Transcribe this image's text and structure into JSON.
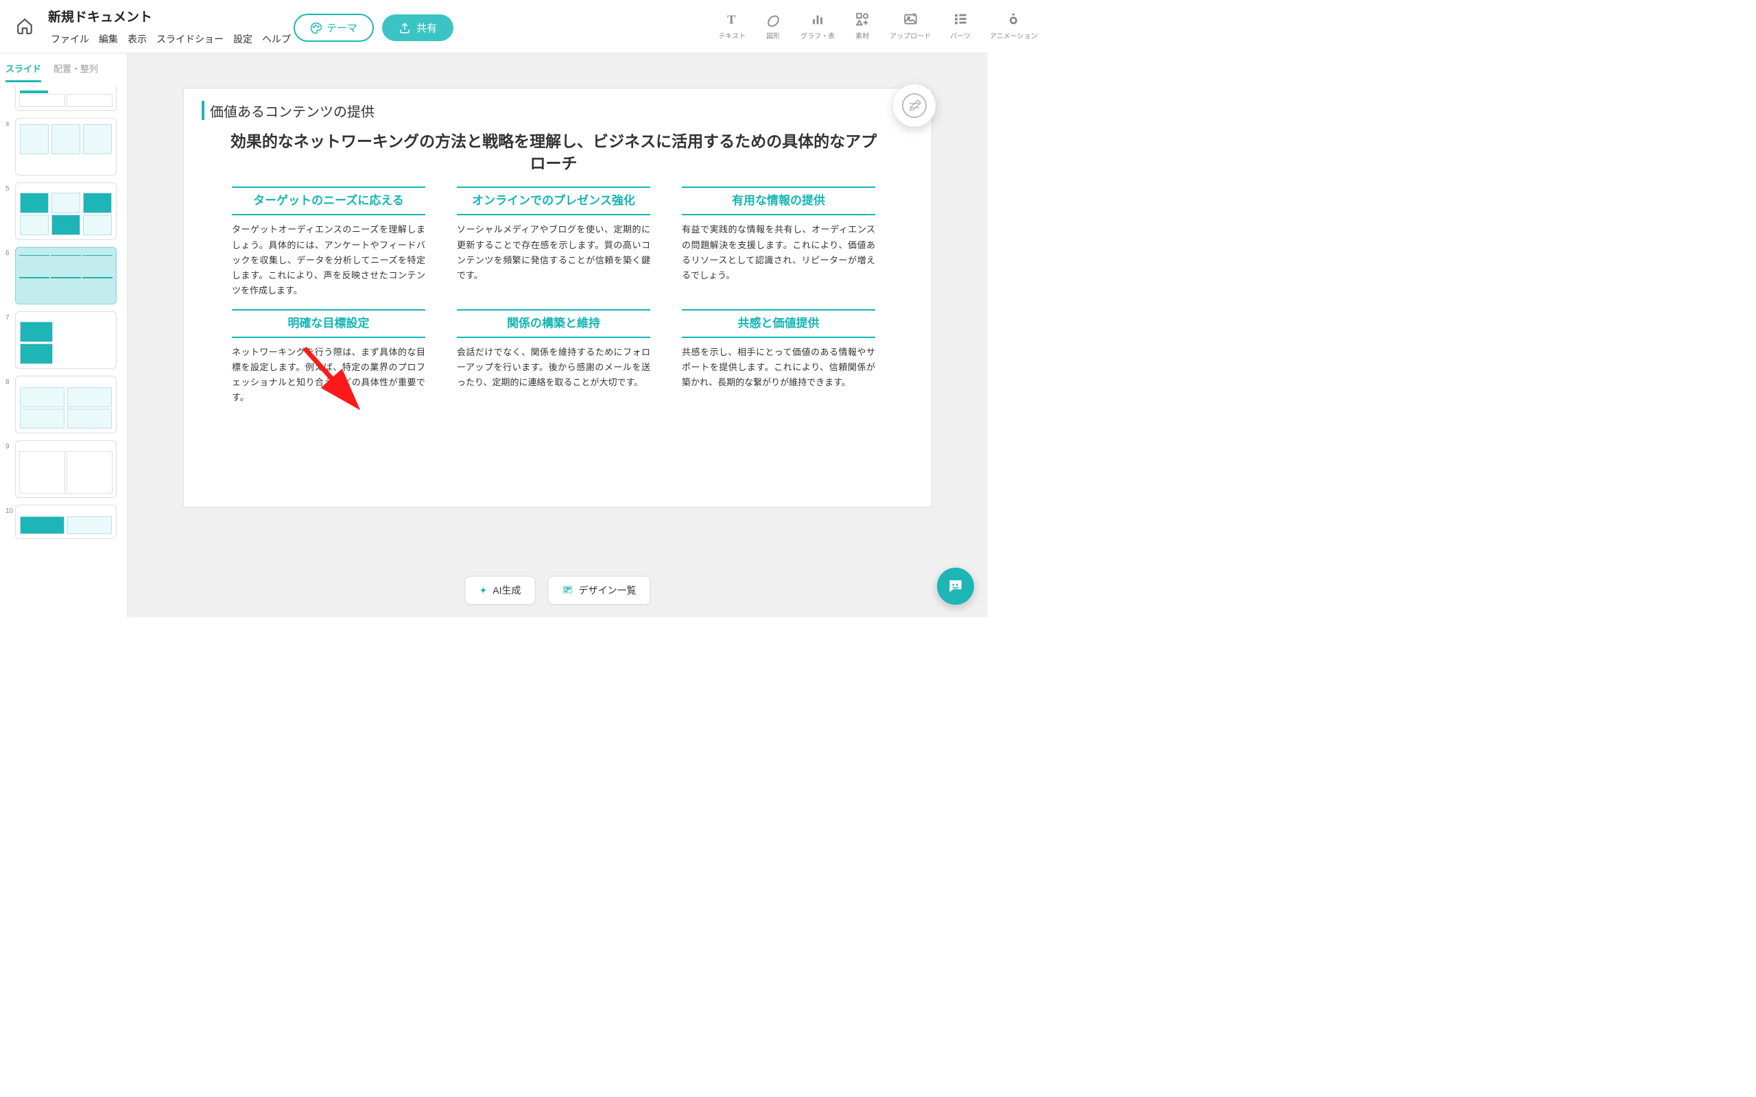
{
  "header": {
    "doc_title": "新規ドキュメント",
    "menu": [
      "ファイル",
      "編集",
      "表示",
      "スライドショー",
      "設定",
      "ヘルプ"
    ],
    "tools": [
      {
        "label": "テキスト"
      },
      {
        "label": "図形"
      },
      {
        "label": "グラフ・表"
      },
      {
        "label": "素材"
      },
      {
        "label": "アップロード"
      },
      {
        "label": "パーツ"
      },
      {
        "label": "アニメーション"
      }
    ],
    "theme_btn": "テーマ",
    "share_btn": "共有"
  },
  "left": {
    "tabs": {
      "slides": "スライド",
      "arrange": "配置・整列"
    },
    "thumb_nums": [
      "4",
      "5",
      "6",
      "7",
      "8",
      "9",
      "10"
    ]
  },
  "slide": {
    "title": "価値あるコンテンツの提供",
    "subtitle": "効果的なネットワーキングの方法と戦略を理解し、ビジネスに活用するための具体的なアプローチ",
    "cells": [
      {
        "title": "ターゲットのニーズに応える",
        "body": "ターゲットオーディエンスのニーズを理解しましょう。具体的には、アンケートやフィードバックを収集し、データを分析してニーズを特定します。これにより、声を反映させたコンテンツを作成します。"
      },
      {
        "title": "オンラインでのプレゼンス強化",
        "body": "ソーシャルメディアやブログを使い、定期的に更新することで存在感を示します。質の高いコンテンツを頻繁に発信することが信頼を築く鍵です。"
      },
      {
        "title": "有用な情報の提供",
        "body": "有益で実践的な情報を共有し、オーディエンスの問題解決を支援します。これにより、価値あるリソースとして認識され、リピーターが増えるでしょう。"
      },
      {
        "title": "明確な目標設定",
        "body": "ネットワーキングを行う際は、まず具体的な目標を設定します。例えば、特定の業界のプロフェッショナルと知り合うなどの具体性が重要です。"
      },
      {
        "title": "関係の構築と維持",
        "body": "会話だけでなく、関係を維持するためにフォローアップを行います。後から感謝のメールを送ったり、定期的に連絡を取ることが大切です。"
      },
      {
        "title": "共感と価値提供",
        "body": "共感を示し、相手にとって価値のある情報やサポートを提供します。これにより、信頼関係が築かれ、長期的な繋がりが維持できます。"
      }
    ]
  },
  "bottom": {
    "ai": "AI生成",
    "design": "デザイン一覧"
  }
}
